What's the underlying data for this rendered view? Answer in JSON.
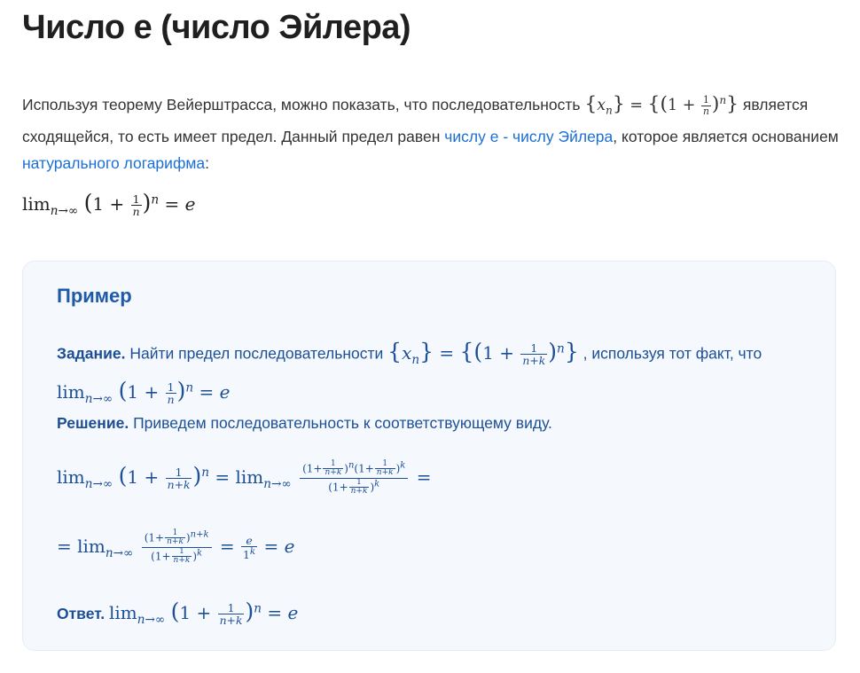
{
  "title": "Число e (число Эйлера)",
  "intro": {
    "part1": "Используя теорему Вейерштрасса, можно показать, что последовательность",
    "part2": "является сходящейся, то есть имеет предел. Данный предел равен",
    "link1": "числу e - числу Эйлера",
    "part3": ", которое является основанием",
    "link2": "натурального логарифма",
    "part4": ":"
  },
  "example": {
    "title": "Пример",
    "task_label": "Задание.",
    "task_text1": "Найти предел последовательности",
    "task_text2": ", используя тот факт, что",
    "solution_label": "Решение.",
    "solution_text": "Приведем последовательность к соответствующему виду.",
    "answer_label": "Ответ."
  },
  "colors": {
    "link": "#1a6fd6",
    "example_bg": "#f5f9fd",
    "example_text": "#1c4f96"
  }
}
